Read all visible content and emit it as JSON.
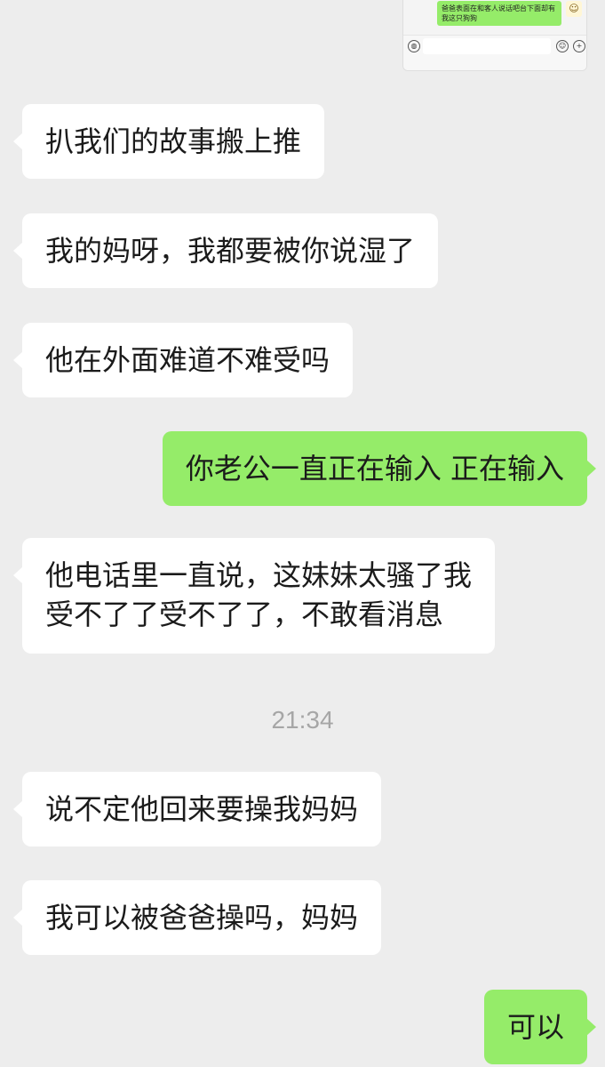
{
  "inset": {
    "bubble_text": "爸爸表面在和客人说话吧台下面却有我这只狗狗",
    "voice_icon": "voice-icon",
    "emoji_icon": "emoji-icon",
    "plus_icon": "plus-icon",
    "emoji_glyph": "☺",
    "plus_glyph": "+",
    "voice_glyph": "◍",
    "avatar_glyph": "☺"
  },
  "messages": [
    {
      "side": "in",
      "text": "扒我们的故事搬上推"
    },
    {
      "side": "in",
      "text": "我的妈呀，我都要被你说湿了"
    },
    {
      "side": "in",
      "text": "他在外面难道不难受吗"
    },
    {
      "side": "out",
      "text": "你老公一直正在输入 正在输入"
    },
    {
      "side": "in",
      "lines": [
        "他电话里一直说，这妹妹太骚了我",
        "受不了了受不了了，不敢看消息"
      ]
    },
    {
      "side": "in",
      "text": "说不定他回来要操我妈妈"
    },
    {
      "side": "in",
      "text": "我可以被爸爸操吗，妈妈"
    },
    {
      "side": "out",
      "text": "可以"
    }
  ],
  "timestamp": "21:34",
  "colors": {
    "background": "#ededed",
    "incoming_bubble": "#ffffff",
    "outgoing_bubble": "#95ec69",
    "timestamp": "#a6a6a6"
  }
}
